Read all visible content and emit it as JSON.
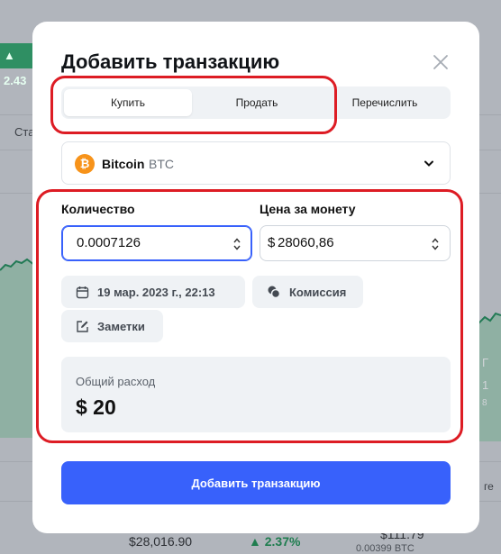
{
  "background": {
    "badge_value": "2.43",
    "left_label": "Ста",
    "right_sign": "Г",
    "right_value": "1",
    "right_frac": "8",
    "bottom_price": "$28,016.90",
    "bottom_change": "2.37%",
    "bottom_amount": "$111.79",
    "bottom_btc": "0.00399 BTC",
    "right_edge_label": "ге"
  },
  "modal": {
    "title": "Добавить транзакцию",
    "tabs": [
      {
        "label": "Купить",
        "active": true
      },
      {
        "label": "Продать",
        "active": false
      },
      {
        "label": "Перечислить",
        "active": false
      }
    ],
    "asset": {
      "icon": "bitcoin-icon",
      "icon_glyph": "₿",
      "name": "Bitcoin",
      "symbol": "BTC"
    },
    "quantity": {
      "label": "Количество",
      "value": "0.0007126"
    },
    "price": {
      "label": "Цена за монету",
      "currency": "$",
      "value": "28060,86"
    },
    "date_chip": {
      "label": "19 мар. 2023 г., 22:13",
      "icon": "calendar-icon"
    },
    "fee_chip": {
      "label": "Комиссия",
      "icon": "coins-icon"
    },
    "notes_chip": {
      "label": "Заметки",
      "icon": "edit-icon"
    },
    "total": {
      "label": "Общий расход",
      "value": "$ 20"
    },
    "submit_label": "Добавить транзакцию"
  },
  "colors": {
    "accent": "#3861fb",
    "annotation": "#dd1c24",
    "bitcoin": "#f7931a"
  }
}
